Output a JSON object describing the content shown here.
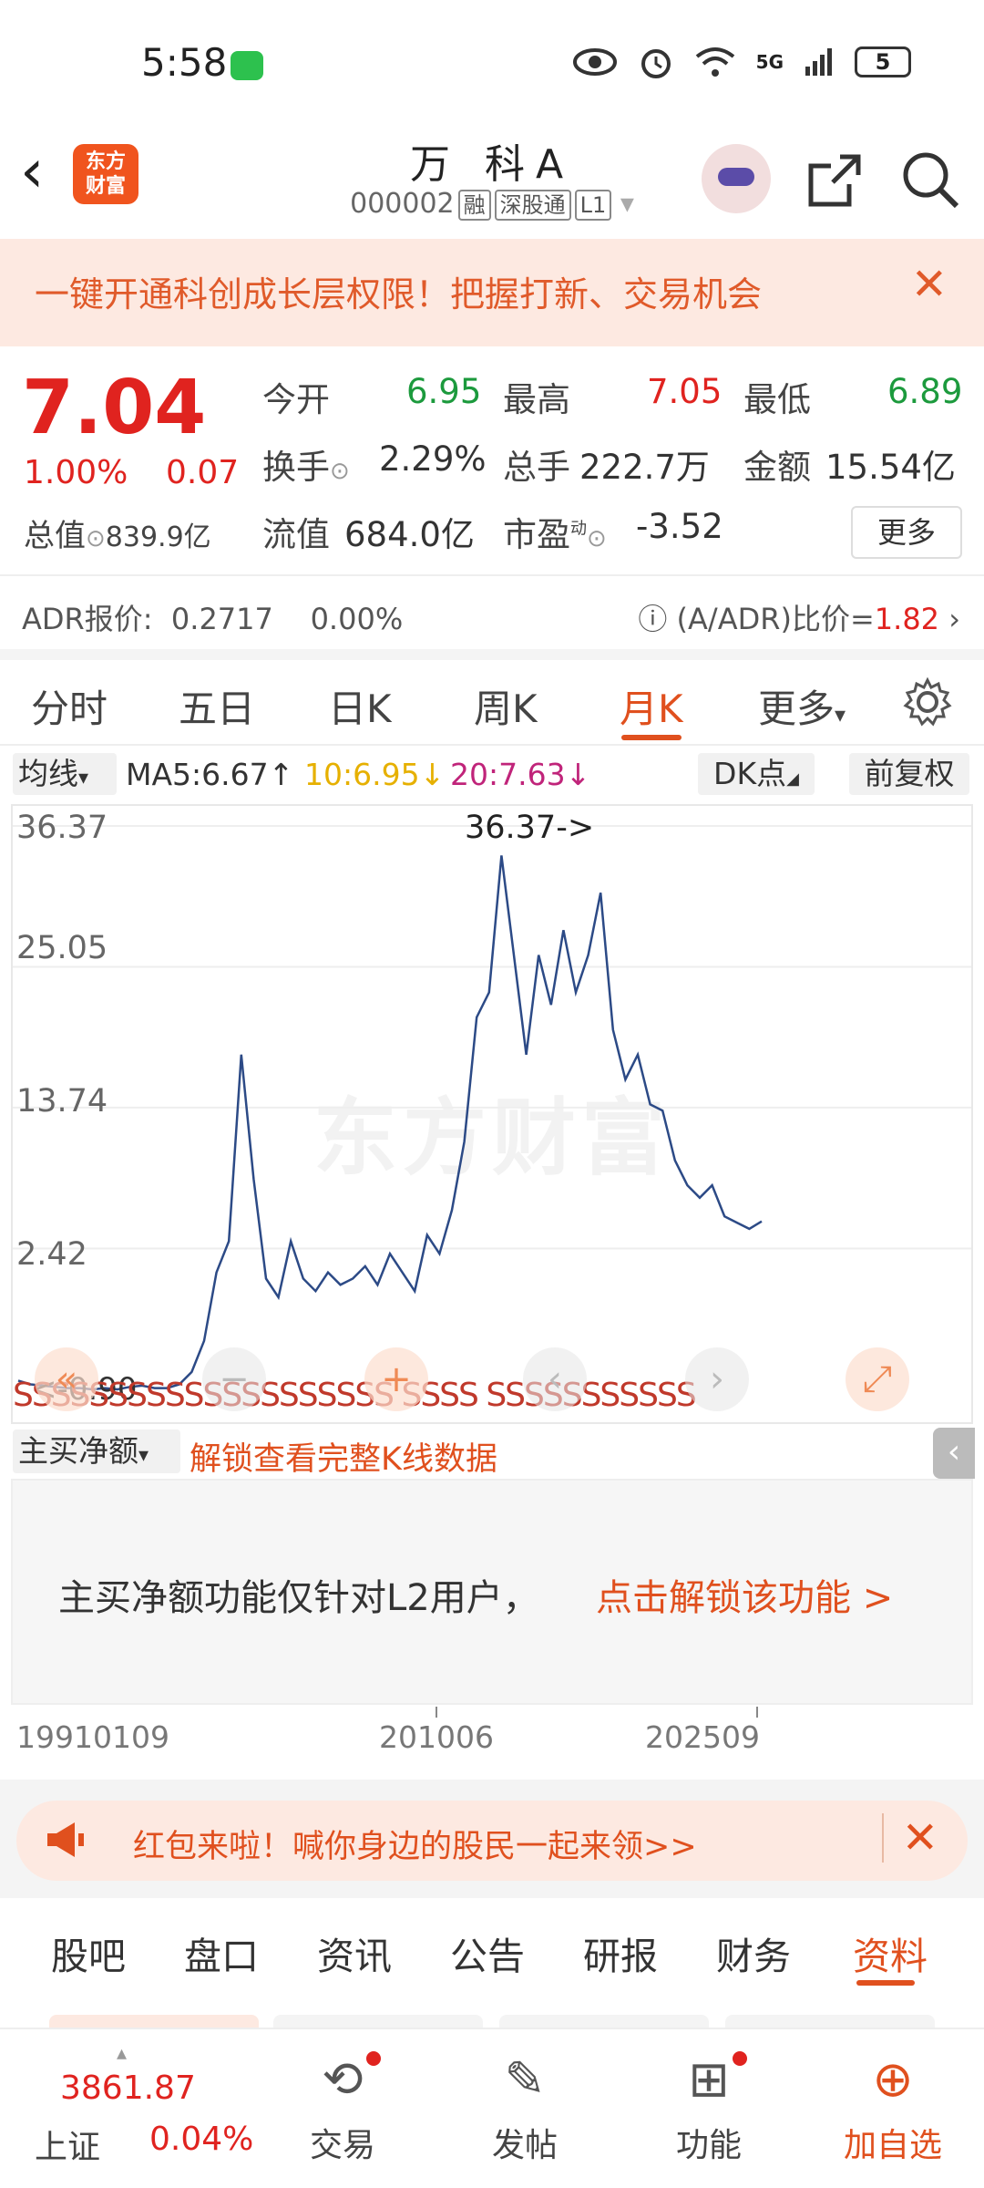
{
  "status_bar": {
    "time": "5:58",
    "battery": "5",
    "network": "5G",
    "icons": [
      "eye-icon",
      "alarm-icon",
      "wifi-icon",
      "signal-icon",
      "battery-icon"
    ]
  },
  "header": {
    "logo_text_line1": "东方",
    "logo_text_line2": "财富",
    "stock_name": "万 科A",
    "stock_code": "000002",
    "tags": [
      "融",
      "深股通",
      "L1"
    ]
  },
  "banner": {
    "text": "一键开通科创成长层权限！把握打新、交易机会"
  },
  "quote": {
    "price": "7.04",
    "change_pct": "1.00%",
    "change_amt": "0.07",
    "open_label": "今开",
    "open": "6.95",
    "high_label": "最高",
    "high": "7.05",
    "low_label": "最低",
    "low": "6.89",
    "turnover_label": "换手",
    "turnover": "2.29%",
    "volume_label": "总手",
    "volume": "222.7万",
    "amount_label": "金额",
    "amount": "15.54亿",
    "total_mv_label": "总值",
    "total_mv": "839.9亿",
    "float_mv_label": "流值",
    "float_mv": "684.0亿",
    "pe_label": "市盈",
    "pe_sup": "动",
    "pe": "-3.52",
    "more": "更多"
  },
  "adr": {
    "label": "ADR报价:",
    "price": "0.2717",
    "pct": "0.00%",
    "ratio_label": "(A/ADR)比价=",
    "ratio": "1.82"
  },
  "kline_tabs": [
    "分时",
    "五日",
    "日K",
    "周K",
    "月K",
    "更多"
  ],
  "ma": {
    "select": "均线",
    "ma5": "MA5:6.67",
    "ma10": "10:6.95",
    "ma20": "20:7.63",
    "dk": "DK点",
    "adjust": "前复权"
  },
  "chart": {
    "watermark": "东方财富",
    "high_marker": "36.37->",
    "low_marker": "<-0.90",
    "ss_text": "SSSSSSSSSSSSSSSSSSSS SSSS SSSSSSSSSSS"
  },
  "chart_data": {
    "type": "line",
    "title": "",
    "xlabel": "",
    "ylabel": "",
    "x_ticks": [
      "199101",
      "201006",
      "202509"
    ],
    "y_ticks": [
      36.37,
      25.05,
      13.74,
      2.42
    ],
    "ylim": [
      -8.9,
      36.37
    ],
    "max_value": 36.37,
    "series": [
      {
        "values": [
          -8.2,
          -8.5,
          -8.6,
          -8.7,
          -8.8,
          -8.8,
          -8.9,
          -8.8,
          -8.9,
          -8.7,
          -8.6,
          -8.8,
          -8.8,
          -8.5,
          -7.5,
          -5.0,
          0.5,
          3.0,
          18.0,
          8.0,
          0.0,
          -1.5,
          3.0,
          0.0,
          -1.0,
          0.5,
          -0.5,
          0.0,
          1.0,
          -0.5,
          2.0,
          0.5,
          -1.0,
          3.5,
          2.0,
          5.5,
          11.0,
          21.0,
          23.0,
          34.0,
          26.0,
          18.0,
          26.0,
          22.0,
          28.0,
          23.0,
          26.0,
          31.0,
          20.0,
          16.0,
          18.0,
          14.0,
          13.5,
          9.5,
          7.5,
          6.5,
          7.5,
          5.0,
          4.5,
          4.0,
          4.6
        ]
      }
    ],
    "grid": true
  },
  "zjz": {
    "select": "主买净额",
    "unlock": "解锁查看完整K线数据",
    "notice": "主买净额功能仅针对L2用户，",
    "notice_link": "点击解锁该功能 >"
  },
  "dates": [
    "19910109",
    "201006",
    "202509"
  ],
  "redpack": {
    "text": "红包来啦！喊你身边的股民一起来领>>"
  },
  "info_tabs": [
    "股吧",
    "盘口",
    "资讯",
    "公告",
    "研报",
    "财务",
    "资料"
  ],
  "bottom": {
    "index_value": "3861.87",
    "index_name": "上证",
    "index_change": "0.04%",
    "items": [
      "交易",
      "发帖",
      "功能",
      "加自选"
    ]
  }
}
